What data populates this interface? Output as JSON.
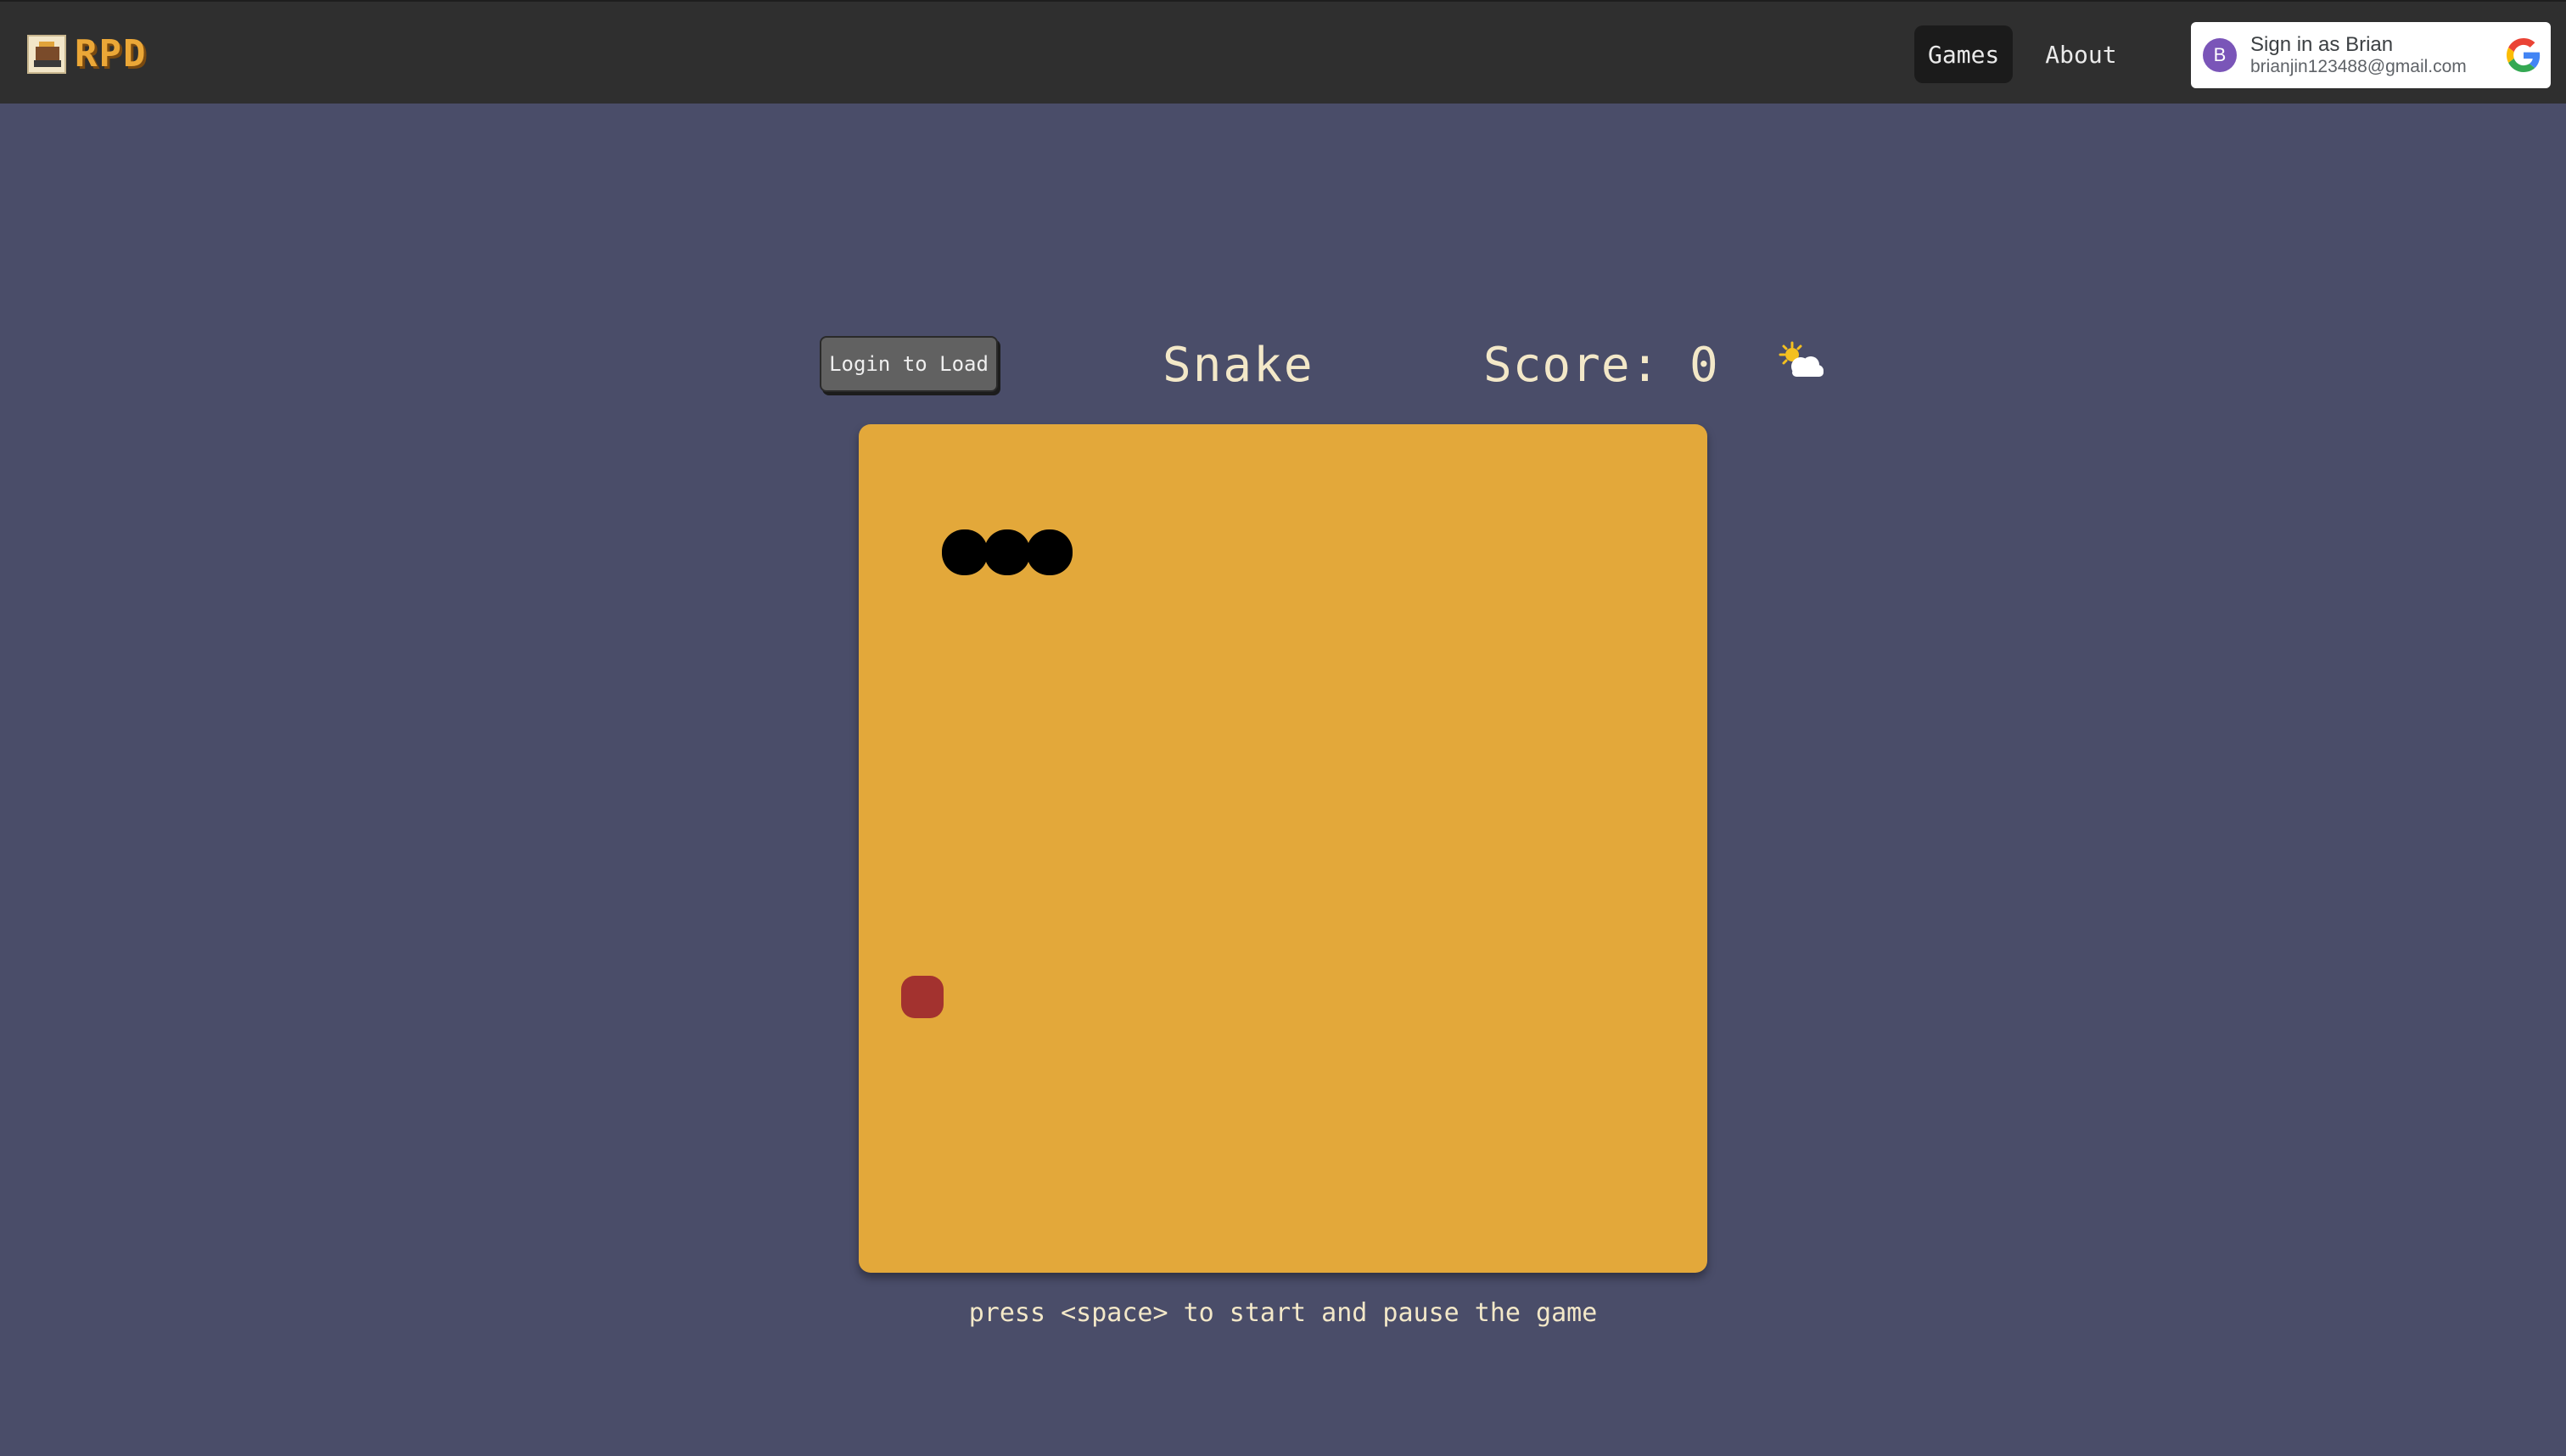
{
  "nav": {
    "brand": "RPD",
    "links": [
      {
        "label": "Games",
        "active": true
      },
      {
        "label": "About",
        "active": false
      }
    ],
    "signin": {
      "avatar_letter": "B",
      "title": "Sign in as Brian",
      "email": "brianjin123488@gmail.com",
      "icon": "google-icon"
    }
  },
  "game": {
    "login_button": "Login to Load",
    "title": "Snake",
    "score_label": "Score: 0",
    "weather_icon": "sun-cloud-icon",
    "hint": "press <space> to start and pause the game",
    "board_color": "#e3a83a",
    "food_color": "#a3322f",
    "snake_color": "#000000",
    "grid_size": 20,
    "snake": [
      [
        2,
        2
      ],
      [
        3,
        2
      ],
      [
        4,
        2
      ]
    ],
    "food": [
      1,
      13
    ]
  }
}
